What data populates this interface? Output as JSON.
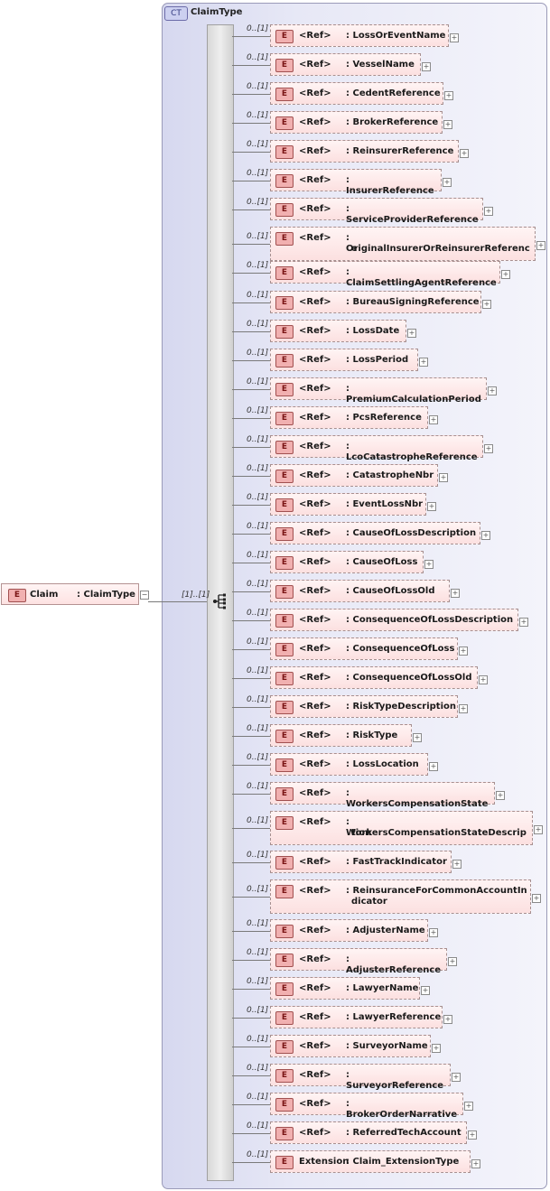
{
  "complex_type": {
    "badge": "CT",
    "name": "ClaimType"
  },
  "root": {
    "badge": "E",
    "name": "Claim",
    "type": ": ClaimType",
    "collapse": "−",
    "multiplicity": "[1]..[1]"
  },
  "elements": [
    {
      "mult": "0..[1]",
      "badge": "E",
      "ref": "<Ref>",
      "name": ": LossOrEventName"
    },
    {
      "mult": "0..[1]",
      "badge": "E",
      "ref": "<Ref>",
      "name": ": VesselName"
    },
    {
      "mult": "0..[1]",
      "badge": "E",
      "ref": "<Ref>",
      "name": ": CedentReference"
    },
    {
      "mult": "0..[1]",
      "badge": "E",
      "ref": "<Ref>",
      "name": ": BrokerReference"
    },
    {
      "mult": "0..[1]",
      "badge": "E",
      "ref": "<Ref>",
      "name": ": ReinsurerReference"
    },
    {
      "mult": "0..[1]",
      "badge": "E",
      "ref": "<Ref>",
      "name": ": InsurerReference"
    },
    {
      "mult": "0..[1]",
      "badge": "E",
      "ref": "<Ref>",
      "name": ": ServiceProviderReference"
    },
    {
      "mult": "0..[1]",
      "badge": "E",
      "ref": "<Ref>",
      "name": ": OriginalInsurerOrReinsurerReferenc",
      "name2": "e"
    },
    {
      "mult": "0..[1]",
      "badge": "E",
      "ref": "<Ref>",
      "name": ": ClaimSettlingAgentReference"
    },
    {
      "mult": "0..[1]",
      "badge": "E",
      "ref": "<Ref>",
      "name": ": BureauSigningReference"
    },
    {
      "mult": "0..[1]",
      "badge": "E",
      "ref": "<Ref>",
      "name": ": LossDate"
    },
    {
      "mult": "0..[1]",
      "badge": "E",
      "ref": "<Ref>",
      "name": ": LossPeriod"
    },
    {
      "mult": "0..[1]",
      "badge": "E",
      "ref": "<Ref>",
      "name": ": PremiumCalculationPeriod"
    },
    {
      "mult": "0..[1]",
      "badge": "E",
      "ref": "<Ref>",
      "name": ": PcsReference"
    },
    {
      "mult": "0..[1]",
      "badge": "E",
      "ref": "<Ref>",
      "name": ": LcoCatastropheReference"
    },
    {
      "mult": "0..[1]",
      "badge": "E",
      "ref": "<Ref>",
      "name": ": CatastropheNbr"
    },
    {
      "mult": "0..[1]",
      "badge": "E",
      "ref": "<Ref>",
      "name": ": EventLossNbr"
    },
    {
      "mult": "0..[1]",
      "badge": "E",
      "ref": "<Ref>",
      "name": ": CauseOfLossDescription"
    },
    {
      "mult": "0..[1]",
      "badge": "E",
      "ref": "<Ref>",
      "name": ": CauseOfLoss"
    },
    {
      "mult": "0..[1]",
      "badge": "E",
      "ref": "<Ref>",
      "name": ": CauseOfLossOld"
    },
    {
      "mult": "0..[1]",
      "badge": "E",
      "ref": "<Ref>",
      "name": ": ConsequenceOfLossDescription"
    },
    {
      "mult": "0..[1]",
      "badge": "E",
      "ref": "<Ref>",
      "name": ": ConsequenceOfLoss"
    },
    {
      "mult": "0..[1]",
      "badge": "E",
      "ref": "<Ref>",
      "name": ": ConsequenceOfLossOld"
    },
    {
      "mult": "0..[1]",
      "badge": "E",
      "ref": "<Ref>",
      "name": ": RiskTypeDescription"
    },
    {
      "mult": "0..[1]",
      "badge": "E",
      "ref": "<Ref>",
      "name": ": RiskType"
    },
    {
      "mult": "0..[1]",
      "badge": "E",
      "ref": "<Ref>",
      "name": ": LossLocation"
    },
    {
      "mult": "0..[1]",
      "badge": "E",
      "ref": "<Ref>",
      "name": ": WorkersCompensationState"
    },
    {
      "mult": "0..[1]",
      "badge": "E",
      "ref": "<Ref>",
      "name": ": WorkersCompensationStateDescrip",
      "name2": "tion"
    },
    {
      "mult": "0..[1]",
      "badge": "E",
      "ref": "<Ref>",
      "name": ": FastTrackIndicator"
    },
    {
      "mult": "0..[1]",
      "badge": "E",
      "ref": "<Ref>",
      "name": ": ReinsuranceForCommonAccountIn",
      "name2": "dicator"
    },
    {
      "mult": "0..[1]",
      "badge": "E",
      "ref": "<Ref>",
      "name": ": AdjusterName"
    },
    {
      "mult": "0..[1]",
      "badge": "E",
      "ref": "<Ref>",
      "name": ": AdjusterReference"
    },
    {
      "mult": "0..[1]",
      "badge": "E",
      "ref": "<Ref>",
      "name": ": LawyerName"
    },
    {
      "mult": "0..[1]",
      "badge": "E",
      "ref": "<Ref>",
      "name": ": LawyerReference"
    },
    {
      "mult": "0..[1]",
      "badge": "E",
      "ref": "<Ref>",
      "name": ": SurveyorName"
    },
    {
      "mult": "0..[1]",
      "badge": "E",
      "ref": "<Ref>",
      "name": ": SurveyorReference"
    },
    {
      "mult": "0..[1]",
      "badge": "E",
      "ref": "<Ref>",
      "name": ": BrokerOrderNarrative"
    },
    {
      "mult": "0..[1]",
      "badge": "E",
      "ref": "<Ref>",
      "name": ": ReferredTechAccount"
    },
    {
      "mult": "0..[1]",
      "badge": "E",
      "ref": "Extension",
      "name": ": Claim_ExtensionType"
    }
  ],
  "expand_symbol": "+"
}
